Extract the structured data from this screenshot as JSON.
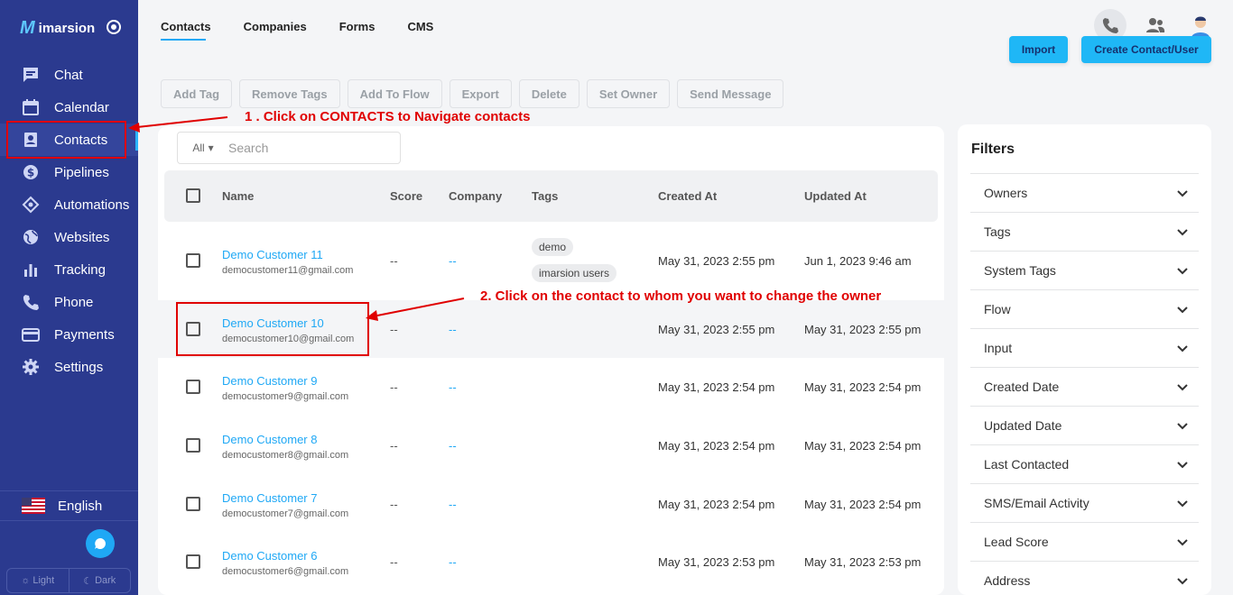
{
  "brand": {
    "logo_mark": "M",
    "name": "imarsion"
  },
  "sidebar": {
    "items": [
      {
        "label": "Chat",
        "icon": "chat-icon"
      },
      {
        "label": "Calendar",
        "icon": "calendar-icon"
      },
      {
        "label": "Contacts",
        "icon": "contacts-icon",
        "active": true
      },
      {
        "label": "Pipelines",
        "icon": "dollar-icon"
      },
      {
        "label": "Automations",
        "icon": "automation-icon"
      },
      {
        "label": "Websites",
        "icon": "globe-icon"
      },
      {
        "label": "Tracking",
        "icon": "bar-chart-icon"
      },
      {
        "label": "Phone",
        "icon": "phone-icon"
      },
      {
        "label": "Payments",
        "icon": "card-icon"
      },
      {
        "label": "Settings",
        "icon": "gear-icon"
      }
    ],
    "language": "English",
    "theme": {
      "light": "Light",
      "dark": "Dark"
    }
  },
  "header": {
    "tabs": [
      "Contacts",
      "Companies",
      "Forms",
      "CMS"
    ],
    "import_label": "Import",
    "create_label": "Create Contact/User"
  },
  "toolbar": [
    "Add Tag",
    "Remove Tags",
    "Add To Flow",
    "Export",
    "Delete",
    "Set Owner",
    "Send Message"
  ],
  "search": {
    "filter": "All",
    "placeholder": "Search"
  },
  "table": {
    "headers": {
      "name": "Name",
      "score": "Score",
      "company": "Company",
      "tags": "Tags",
      "created": "Created At",
      "updated": "Updated At"
    },
    "rows": [
      {
        "name": "Demo Customer 11",
        "email": "democustomer11@gmail.com",
        "score": "--",
        "company": "--",
        "tags": [
          "demo",
          "imarsion users"
        ],
        "created": "May 31, 2023 2:55 pm",
        "updated": "Jun 1, 2023 9:46 am"
      },
      {
        "name": "Demo Customer 10",
        "email": "democustomer10@gmail.com",
        "score": "--",
        "company": "--",
        "tags": [],
        "created": "May 31, 2023 2:55 pm",
        "updated": "May 31, 2023 2:55 pm"
      },
      {
        "name": "Demo Customer 9",
        "email": "democustomer9@gmail.com",
        "score": "--",
        "company": "--",
        "tags": [],
        "created": "May 31, 2023 2:54 pm",
        "updated": "May 31, 2023 2:54 pm"
      },
      {
        "name": "Demo Customer 8",
        "email": "democustomer8@gmail.com",
        "score": "--",
        "company": "--",
        "tags": [],
        "created": "May 31, 2023 2:54 pm",
        "updated": "May 31, 2023 2:54 pm"
      },
      {
        "name": "Demo Customer 7",
        "email": "democustomer7@gmail.com",
        "score": "--",
        "company": "--",
        "tags": [],
        "created": "May 31, 2023 2:54 pm",
        "updated": "May 31, 2023 2:54 pm"
      },
      {
        "name": "Demo Customer 6",
        "email": "democustomer6@gmail.com",
        "score": "--",
        "company": "--",
        "tags": [],
        "created": "May 31, 2023 2:53 pm",
        "updated": "May 31, 2023 2:53 pm"
      }
    ]
  },
  "filters": {
    "title": "Filters",
    "items": [
      "Owners",
      "Tags",
      "System Tags",
      "Flow",
      "Input",
      "Created Date",
      "Updated Date",
      "Last Contacted",
      "SMS/Email Activity",
      "Lead Score",
      "Address"
    ]
  },
  "annotations": {
    "step1": "1 . Click on CONTACTS to Navigate contacts",
    "step2": "2. Click on the contact to whom you want to change the owner",
    "color": "#e00000"
  }
}
